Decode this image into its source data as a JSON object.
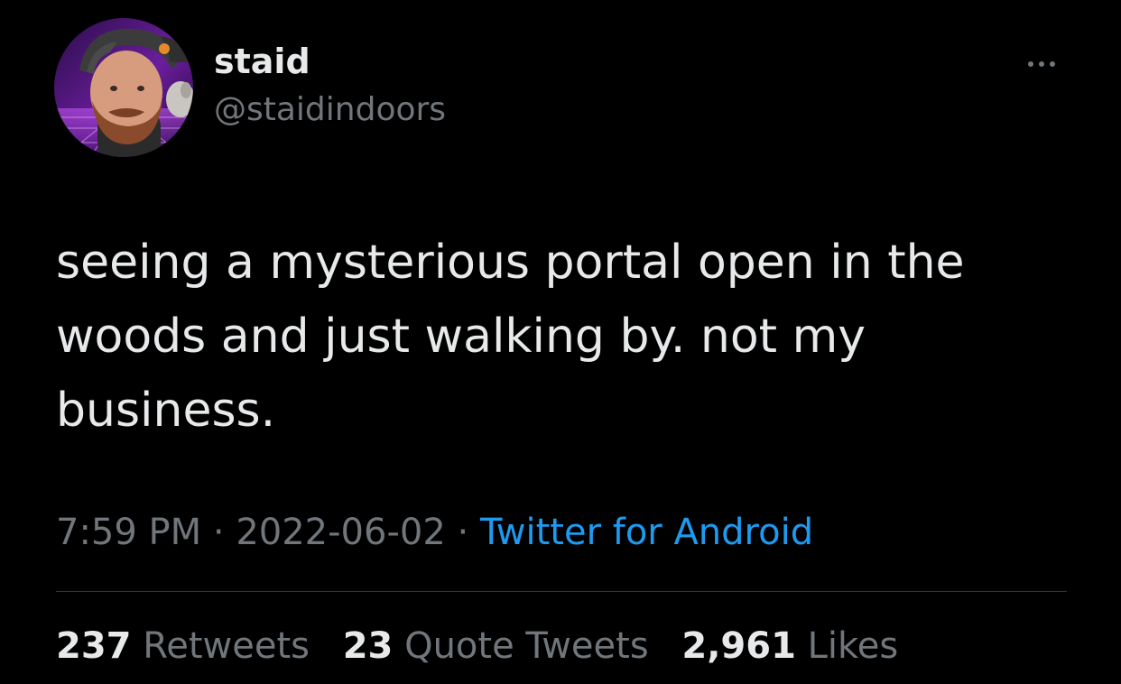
{
  "author": {
    "display_name": "staid",
    "handle": "@staidindoors"
  },
  "tweet": {
    "text": "seeing a mysterious portal open in the\nwoods and just walking by. not my\nbusiness."
  },
  "meta": {
    "time": "7:59 PM",
    "separator": "·",
    "date": "2022-06-02",
    "source": "Twitter for Android"
  },
  "stats": {
    "retweets_count": "237",
    "retweets_label": "Retweets",
    "quotes_count": "23",
    "quotes_label": "Quote Tweets",
    "likes_count": "2,961",
    "likes_label": "Likes"
  },
  "icons": {
    "more": "more-horizontal-icon"
  },
  "colors": {
    "background": "#000000",
    "text_primary": "#e7e9ea",
    "text_secondary": "#71767b",
    "link": "#1d9bf0",
    "divider": "#2f3336"
  }
}
